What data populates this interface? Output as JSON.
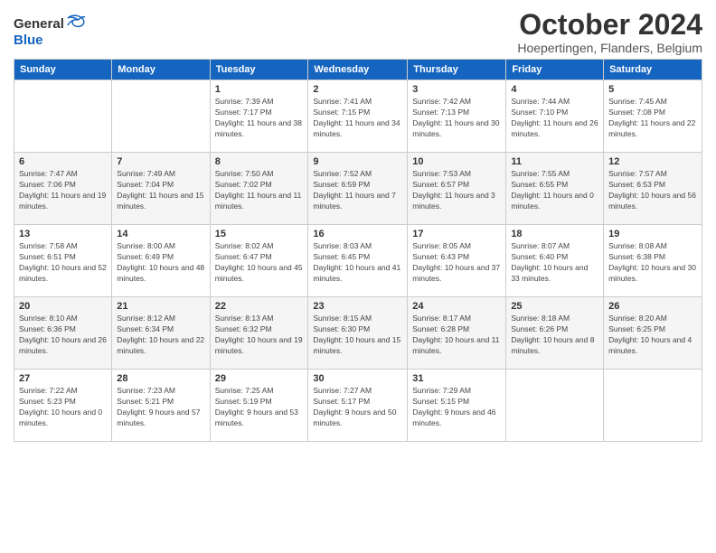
{
  "header": {
    "logo_general": "General",
    "logo_blue": "Blue",
    "month_year": "October 2024",
    "location": "Hoepertingen, Flanders, Belgium"
  },
  "weekdays": [
    "Sunday",
    "Monday",
    "Tuesday",
    "Wednesday",
    "Thursday",
    "Friday",
    "Saturday"
  ],
  "weeks": [
    [
      {
        "day": "",
        "detail": ""
      },
      {
        "day": "",
        "detail": ""
      },
      {
        "day": "1",
        "detail": "Sunrise: 7:39 AM\nSunset: 7:17 PM\nDaylight: 11 hours and 38 minutes."
      },
      {
        "day": "2",
        "detail": "Sunrise: 7:41 AM\nSunset: 7:15 PM\nDaylight: 11 hours and 34 minutes."
      },
      {
        "day": "3",
        "detail": "Sunrise: 7:42 AM\nSunset: 7:13 PM\nDaylight: 11 hours and 30 minutes."
      },
      {
        "day": "4",
        "detail": "Sunrise: 7:44 AM\nSunset: 7:10 PM\nDaylight: 11 hours and 26 minutes."
      },
      {
        "day": "5",
        "detail": "Sunrise: 7:45 AM\nSunset: 7:08 PM\nDaylight: 11 hours and 22 minutes."
      }
    ],
    [
      {
        "day": "6",
        "detail": "Sunrise: 7:47 AM\nSunset: 7:06 PM\nDaylight: 11 hours and 19 minutes."
      },
      {
        "day": "7",
        "detail": "Sunrise: 7:49 AM\nSunset: 7:04 PM\nDaylight: 11 hours and 15 minutes."
      },
      {
        "day": "8",
        "detail": "Sunrise: 7:50 AM\nSunset: 7:02 PM\nDaylight: 11 hours and 11 minutes."
      },
      {
        "day": "9",
        "detail": "Sunrise: 7:52 AM\nSunset: 6:59 PM\nDaylight: 11 hours and 7 minutes."
      },
      {
        "day": "10",
        "detail": "Sunrise: 7:53 AM\nSunset: 6:57 PM\nDaylight: 11 hours and 3 minutes."
      },
      {
        "day": "11",
        "detail": "Sunrise: 7:55 AM\nSunset: 6:55 PM\nDaylight: 11 hours and 0 minutes."
      },
      {
        "day": "12",
        "detail": "Sunrise: 7:57 AM\nSunset: 6:53 PM\nDaylight: 10 hours and 56 minutes."
      }
    ],
    [
      {
        "day": "13",
        "detail": "Sunrise: 7:58 AM\nSunset: 6:51 PM\nDaylight: 10 hours and 52 minutes."
      },
      {
        "day": "14",
        "detail": "Sunrise: 8:00 AM\nSunset: 6:49 PM\nDaylight: 10 hours and 48 minutes."
      },
      {
        "day": "15",
        "detail": "Sunrise: 8:02 AM\nSunset: 6:47 PM\nDaylight: 10 hours and 45 minutes."
      },
      {
        "day": "16",
        "detail": "Sunrise: 8:03 AM\nSunset: 6:45 PM\nDaylight: 10 hours and 41 minutes."
      },
      {
        "day": "17",
        "detail": "Sunrise: 8:05 AM\nSunset: 6:43 PM\nDaylight: 10 hours and 37 minutes."
      },
      {
        "day": "18",
        "detail": "Sunrise: 8:07 AM\nSunset: 6:40 PM\nDaylight: 10 hours and 33 minutes."
      },
      {
        "day": "19",
        "detail": "Sunrise: 8:08 AM\nSunset: 6:38 PM\nDaylight: 10 hours and 30 minutes."
      }
    ],
    [
      {
        "day": "20",
        "detail": "Sunrise: 8:10 AM\nSunset: 6:36 PM\nDaylight: 10 hours and 26 minutes."
      },
      {
        "day": "21",
        "detail": "Sunrise: 8:12 AM\nSunset: 6:34 PM\nDaylight: 10 hours and 22 minutes."
      },
      {
        "day": "22",
        "detail": "Sunrise: 8:13 AM\nSunset: 6:32 PM\nDaylight: 10 hours and 19 minutes."
      },
      {
        "day": "23",
        "detail": "Sunrise: 8:15 AM\nSunset: 6:30 PM\nDaylight: 10 hours and 15 minutes."
      },
      {
        "day": "24",
        "detail": "Sunrise: 8:17 AM\nSunset: 6:28 PM\nDaylight: 10 hours and 11 minutes."
      },
      {
        "day": "25",
        "detail": "Sunrise: 8:18 AM\nSunset: 6:26 PM\nDaylight: 10 hours and 8 minutes."
      },
      {
        "day": "26",
        "detail": "Sunrise: 8:20 AM\nSunset: 6:25 PM\nDaylight: 10 hours and 4 minutes."
      }
    ],
    [
      {
        "day": "27",
        "detail": "Sunrise: 7:22 AM\nSunset: 5:23 PM\nDaylight: 10 hours and 0 minutes."
      },
      {
        "day": "28",
        "detail": "Sunrise: 7:23 AM\nSunset: 5:21 PM\nDaylight: 9 hours and 57 minutes."
      },
      {
        "day": "29",
        "detail": "Sunrise: 7:25 AM\nSunset: 5:19 PM\nDaylight: 9 hours and 53 minutes."
      },
      {
        "day": "30",
        "detail": "Sunrise: 7:27 AM\nSunset: 5:17 PM\nDaylight: 9 hours and 50 minutes."
      },
      {
        "day": "31",
        "detail": "Sunrise: 7:29 AM\nSunset: 5:15 PM\nDaylight: 9 hours and 46 minutes."
      },
      {
        "day": "",
        "detail": ""
      },
      {
        "day": "",
        "detail": ""
      }
    ]
  ]
}
